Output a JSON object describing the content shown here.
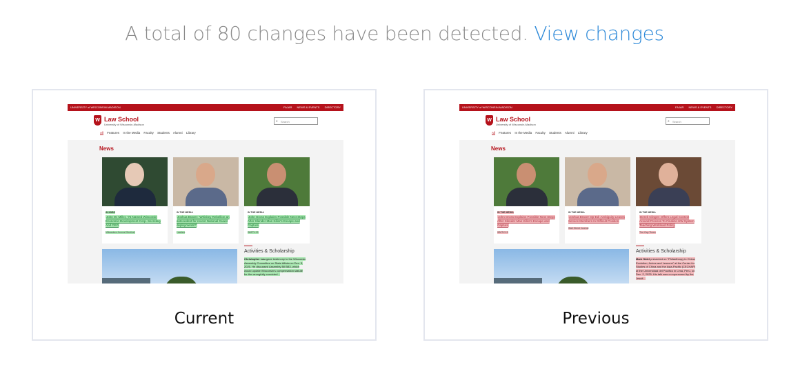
{
  "headline": {
    "text": "A total of 80 changes have been detected.",
    "link": "View changes"
  },
  "panels": {
    "current": {
      "label": "Current",
      "site": {
        "topbar_left": "UNIVERSITY of WISCONSIN-MADISON",
        "topbar_links": [
          "FAJAR",
          "NEWS & EVENTS",
          "DIRECTORY"
        ],
        "title": "Law School",
        "subtitle": "University of Wisconsin-Madison",
        "search_placeholder": "Search",
        "tabs": [
          "All",
          "Features",
          "In the Media",
          "Faculty",
          "Students",
          "Alumni",
          "Library"
        ],
        "news_heading": "News",
        "tiles": [
          {
            "kicker": "ALUMNI",
            "title": "John W. Miller, '76 Named Wisconsin Economic Development Corp. Secretary And CEO",
            "source": "Milwaukee Journal Sentinel"
          },
          {
            "kicker": "IN THE MEDIA",
            "title": "Joshua Braver: 'Whiskey Rebellion an antecedent for recent National Guard deployments?'",
            "source": "Lawfare"
          },
          {
            "kicker": "IN THE MEDIA",
            "title": "John Gross Explains Possible Next Steps After Slender Man Killer's Escape and Capture",
            "source": "WMTV-15"
          }
        ],
        "activities_heading": "Activities & Scholarship",
        "activities_name": "Christopher Lau",
        "activities_text": "gave testimony to the Wisconsin Assembly Committee on State Affairs on Dec. 3, 2025. He discussed Assembly Bill 583, which would update Wisconsin's compensation statute for the wrongfully convicted..."
      }
    },
    "previous": {
      "label": "Previous",
      "site": {
        "topbar_left": "UNIVERSITY of WISCONSIN-MADISON",
        "topbar_links": [
          "FAJAR",
          "NEWS & EVENTS",
          "DIRECTORY"
        ],
        "title": "Law School",
        "subtitle": "University of Wisconsin-Madison",
        "search_placeholder": "Search",
        "tabs": [
          "All",
          "Features",
          "In the Media",
          "Faculty",
          "Students",
          "Alumni",
          "Library"
        ],
        "news_heading": "News",
        "tiles": [
          {
            "kicker": "IN THE MEDIA",
            "title": "John Gross Explains Possible Next Steps After Slender Man Killer's Escape and Capture",
            "source": "WMTV-15"
          },
          {
            "kicker": "IN THE MEDIA",
            "title": "Joshua Braver Op-Ed: Ambiguity Leaves Service Members In Difficult Position",
            "source": "Wall Street Journal"
          },
          {
            "kicker": "IN THE MEDIA",
            "title": "Derek Clinger: Offers Legal Context Around Process To Finalize UW System Teaching Workload Policy",
            "source": "The Cap Times"
          }
        ],
        "activities_heading": "Activities & Scholarship",
        "activities_name": "Mark Sidel",
        "activities_text": "presented on \"Philanthropy in China: Evolution, Actors and Lessons\" at the Center for Studies of China and the Asia-Pacific (CECHAP) at the Universidad del Pacífico in Lima, Peru, on Dec. 2, 2025. His talk was co-sponsored by the Jesuit..."
      }
    }
  }
}
